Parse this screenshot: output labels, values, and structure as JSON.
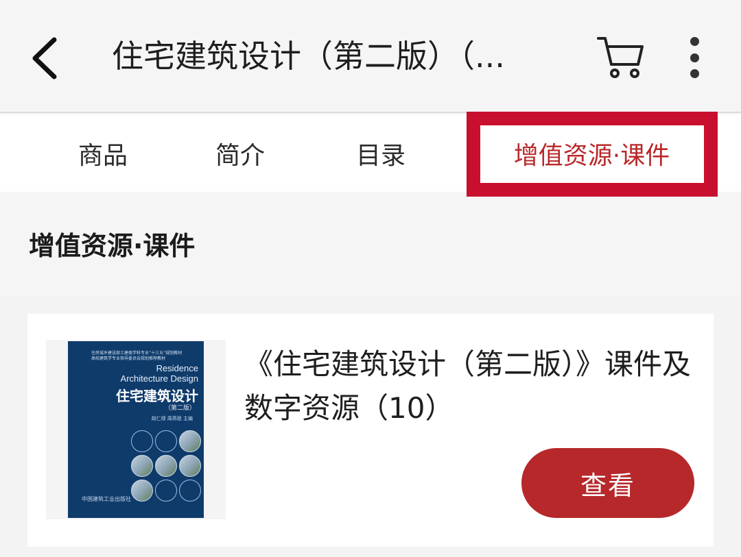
{
  "header": {
    "title": "住宅建筑设计（第二版）（...",
    "back_icon": "chevron-left-icon",
    "cart_icon": "cart-icon",
    "more_icon": "more-vertical-icon"
  },
  "tabs": [
    {
      "label": "商品",
      "active": false
    },
    {
      "label": "简介",
      "active": false
    },
    {
      "label": "目录",
      "active": false
    },
    {
      "label": "增值资源·课件",
      "active": true
    }
  ],
  "section": {
    "title": "增值资源·课件"
  },
  "resource": {
    "title": "《住宅建筑设计（第二版）》课件及数字资源（10）",
    "view_label": "查看",
    "cover": {
      "series_line1": "住房城乡建设部土建类学科专业“十三五”规划教材",
      "series_line2": "高校建筑学专业指导委员会规划推荐教材",
      "en_line1": "Residence",
      "en_line2": "Architecture Design",
      "cn_title": "住宅建筑设计",
      "edition": "（第二版）",
      "authors": "胡仁禄 周燕珉 主编",
      "publisher": "中国建筑工业出版社"
    }
  },
  "colors": {
    "accent": "#b6282a",
    "highlight_box": "#c8102e",
    "cover_blue": "#0f3b6b",
    "background": "#f5f5f5"
  }
}
